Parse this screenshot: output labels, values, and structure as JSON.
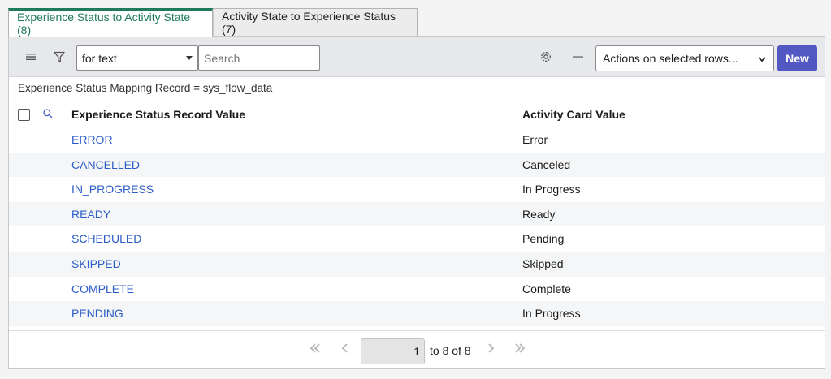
{
  "tabs": [
    {
      "label": "Experience Status to Activity State (8)",
      "active": true
    },
    {
      "label": "Activity State to Experience Status (7)",
      "active": false
    }
  ],
  "toolbar": {
    "filter_field": "for text",
    "search_placeholder": "Search",
    "actions_label": "Actions on selected rows...",
    "new_label": "New"
  },
  "breadcrumb": "Experience Status Mapping Record = sys_flow_data",
  "table": {
    "columns": [
      "Experience Status Record Value",
      "Activity Card Value"
    ],
    "rows": [
      {
        "record": "ERROR",
        "card": "Error"
      },
      {
        "record": "CANCELLED",
        "card": "Canceled"
      },
      {
        "record": "IN_PROGRESS",
        "card": "In Progress"
      },
      {
        "record": "READY",
        "card": "Ready"
      },
      {
        "record": "SCHEDULED",
        "card": "Pending"
      },
      {
        "record": "SKIPPED",
        "card": "Skipped"
      },
      {
        "record": "COMPLETE",
        "card": "Complete"
      },
      {
        "record": "PENDING",
        "card": "In Progress"
      }
    ]
  },
  "pagination": {
    "current": "1",
    "range_text": "to 8 of 8"
  },
  "colors": {
    "accent": "#1f7a5a",
    "link": "#2b5cc8",
    "primary_button": "#5258c2"
  }
}
